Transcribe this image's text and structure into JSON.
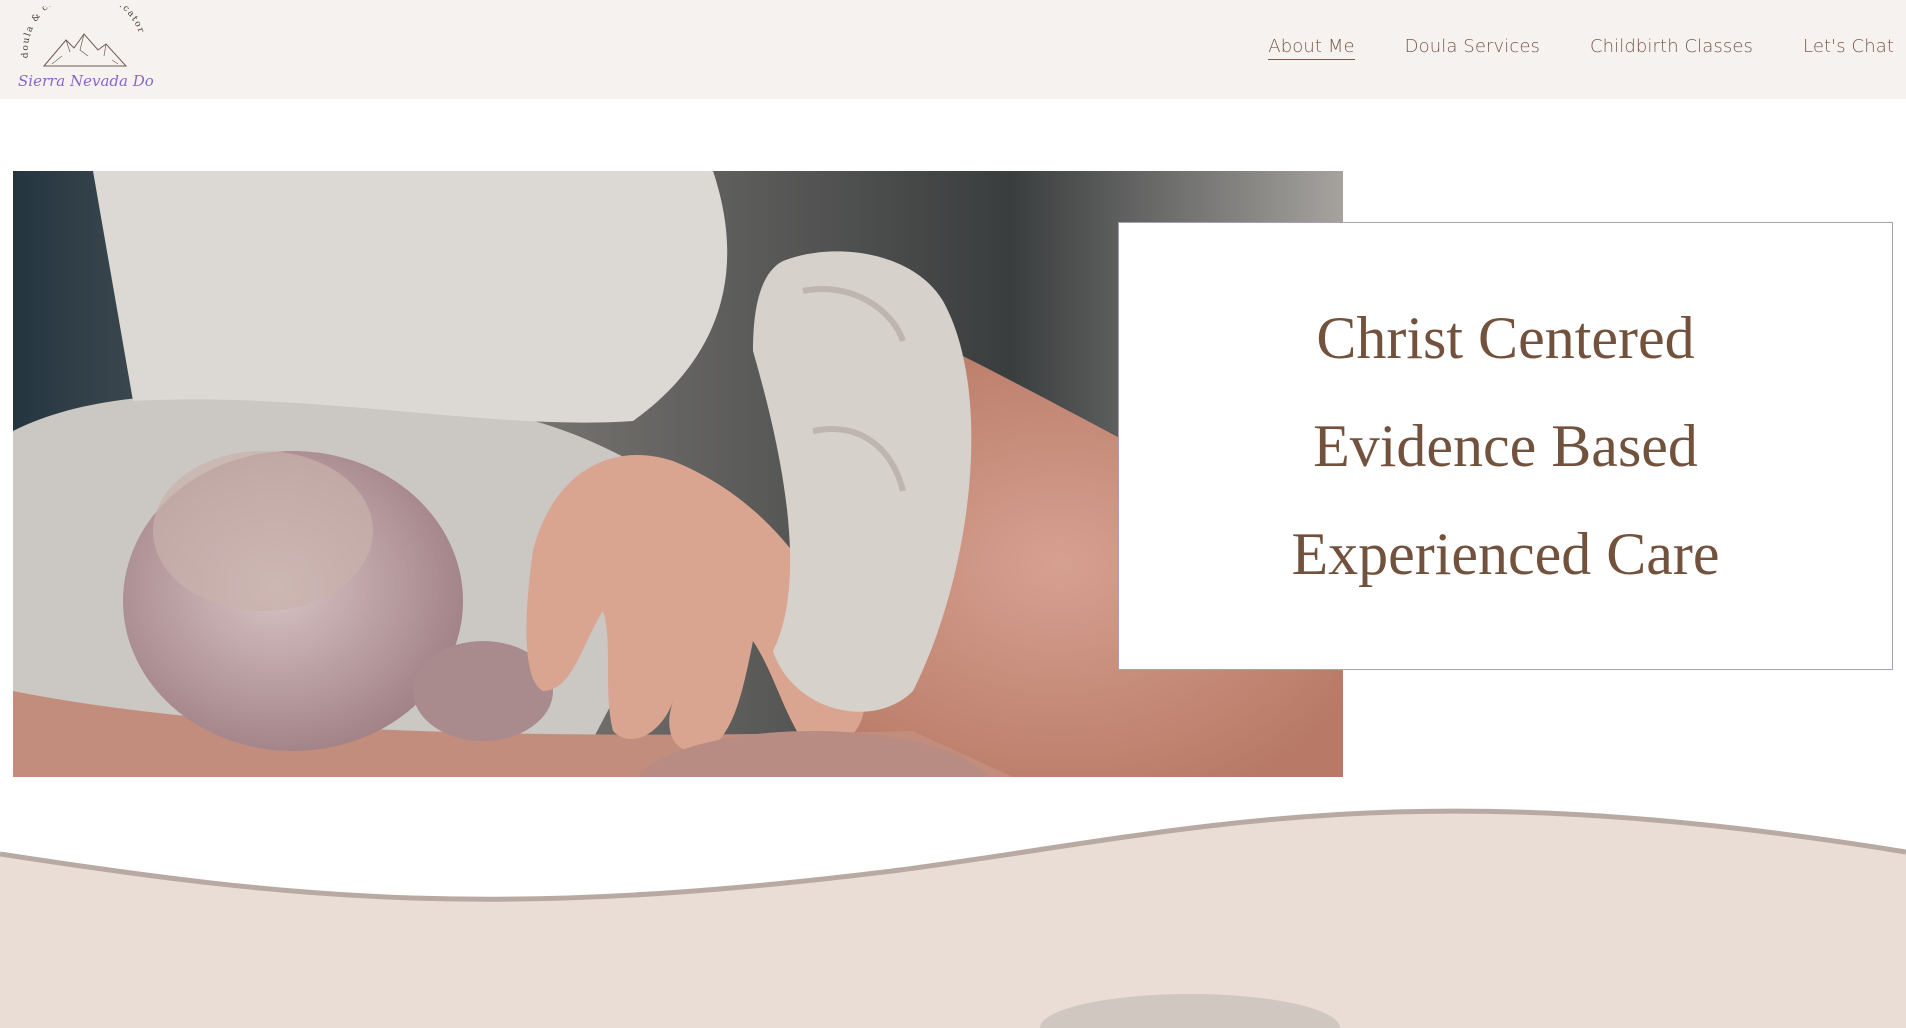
{
  "brand": {
    "tagline_arc": "doula & childbirth educator",
    "name_script": "Sierra Nevada Doula"
  },
  "nav": {
    "items": [
      {
        "label": "About Me",
        "active": true
      },
      {
        "label": "Doula Services",
        "active": false
      },
      {
        "label": "Childbirth Classes",
        "active": false
      },
      {
        "label": "Let's Chat",
        "active": false
      }
    ]
  },
  "hero": {
    "lines": [
      "Christ Centered",
      "Evidence Based",
      "Experienced Care"
    ]
  },
  "colors": {
    "header_bg": "#f6f2ef",
    "nav_text": "#7a5a4d",
    "tagline_text": "#73523d",
    "card_border": "#a79fb3",
    "wave_fill": "#eaddd5",
    "wave_stroke": "#b8aaa2",
    "logo_script": "#8a66c9"
  },
  "icons": {
    "logo": "mountain-logo-icon"
  }
}
